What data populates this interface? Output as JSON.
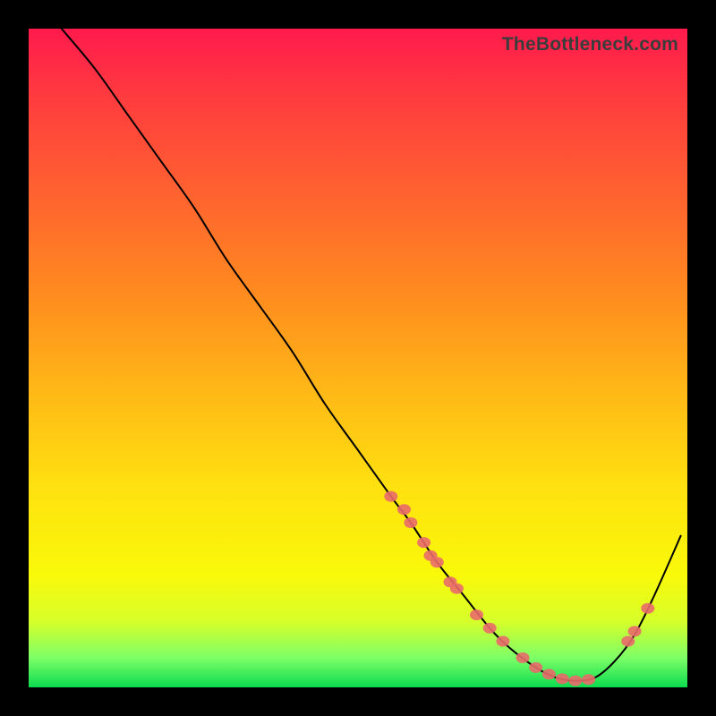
{
  "watermark": "TheBottleneck.com",
  "colors": {
    "dot": "#e96a6a",
    "curve": "#000000",
    "frame": "#000000"
  },
  "chart_data": {
    "type": "line",
    "title": "",
    "xlabel": "",
    "ylabel": "",
    "xlim": [
      0,
      100
    ],
    "ylim": [
      0,
      100
    ],
    "grid": false,
    "legend": false,
    "note": "Axes/ticks not shown; values are relative percentages inferred from gradient background (0 = bottom/green = optimal, 100 = top/red = severe bottleneck). x is relative horizontal position across the plot.",
    "series": [
      {
        "name": "bottleneck-curve",
        "x": [
          5,
          10,
          15,
          20,
          25,
          30,
          35,
          40,
          45,
          50,
          55,
          58,
          62,
          66,
          70,
          73,
          77,
          80,
          83,
          86,
          89,
          92,
          95,
          99
        ],
        "y": [
          100,
          94,
          87,
          80,
          73,
          65,
          58,
          51,
          43,
          36,
          29,
          25,
          19,
          14,
          9,
          6,
          3,
          1.5,
          1,
          1.5,
          4,
          8,
          14,
          23
        ]
      }
    ],
    "markers": {
      "name": "sample-points",
      "note": "Salmon dots shown along the curve toward the minimum region",
      "x": [
        55,
        57,
        58,
        60,
        61,
        62,
        64,
        65,
        68,
        70,
        72,
        75,
        77,
        79,
        81,
        83,
        85,
        91,
        92,
        94
      ],
      "y": [
        29,
        27,
        25,
        22,
        20,
        19,
        16,
        15,
        11,
        9,
        7,
        4.5,
        3,
        2,
        1.3,
        1,
        1.2,
        7,
        8.5,
        12
      ]
    }
  }
}
